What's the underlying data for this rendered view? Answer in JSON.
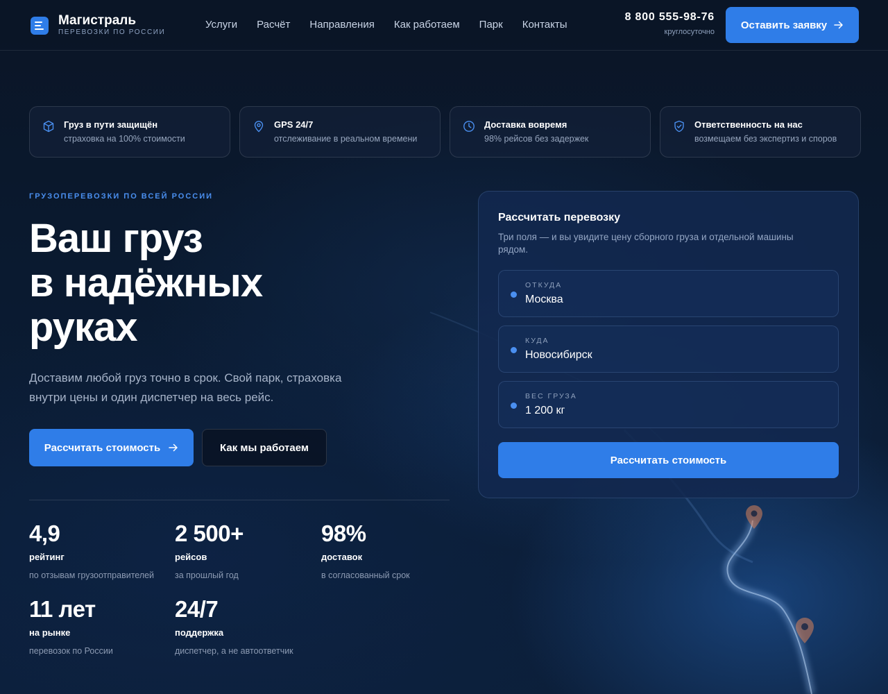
{
  "brand": {
    "name": "Магистраль",
    "tagline": "ПЕРЕВОЗКИ ПО РОССИИ"
  },
  "nav": [
    "Услуги",
    "Расчёт",
    "Направления",
    "Как работаем",
    "Парк",
    "Контакты"
  ],
  "contact": {
    "phone": "8 800 555-98-76",
    "hours": "круглосуточно"
  },
  "header": {
    "cta_label": "Оставить заявку"
  },
  "features": [
    {
      "icon": "box-icon",
      "title": "Груз в пути защищён",
      "subtitle": "страховка на 100% стоимости"
    },
    {
      "icon": "location-pin-icon",
      "title": "GPS 24/7",
      "subtitle": "отслеживание в реальном времени"
    },
    {
      "icon": "clock-icon",
      "title": "Доставка вовремя",
      "subtitle": "98% рейсов без задержек"
    },
    {
      "icon": "shield-check-icon",
      "title": "Ответственность на нас",
      "subtitle": "возмещаем без экспертиз и споров"
    }
  ],
  "hero": {
    "eyebrow": "ГРУЗОПЕРЕВОЗКИ ПО ВСЕЙ РОССИИ",
    "title_lines": [
      "Ваш груз",
      "в надёжных",
      "руках"
    ],
    "description": "Доставим любой груз точно в срок. Свой парк, страховка внутри цены и один диспетчер на весь рейс.",
    "primary_label": "Рассчитать стоимость",
    "secondary_label": "Как мы работаем"
  },
  "stats": [
    {
      "value": "4,9",
      "label": "рейтинг",
      "sub": "по отзывам грузоотправителей"
    },
    {
      "value": "2 500+",
      "label": "рейсов",
      "sub": "за прошлый год"
    },
    {
      "value": "98%",
      "label": "доставок",
      "sub": "в согласованный срок"
    },
    {
      "value": "11 лет",
      "label": "на рынке",
      "sub": "перевозок по России"
    },
    {
      "value": "24/7",
      "label": "поддержка",
      "sub": "диспетчер, а не автоответчик"
    }
  ],
  "calculator": {
    "title": "Рассчитать перевозку",
    "description": "Три поля — и вы увидите цену сборного груза и отдельной машины рядом.",
    "fields": [
      {
        "label": "ОТКУДА",
        "value": "Москва"
      },
      {
        "label": "КУДА",
        "value": "Новосибирск"
      },
      {
        "label": "ВЕС ГРУЗА",
        "value": "1 200 кг"
      }
    ],
    "submit_label": "Рассчитать стоимость"
  },
  "colors": {
    "accent": "#2f7de8",
    "accent_text": "#4a8ff0",
    "background": "#0a1628",
    "card": "#12284e"
  }
}
